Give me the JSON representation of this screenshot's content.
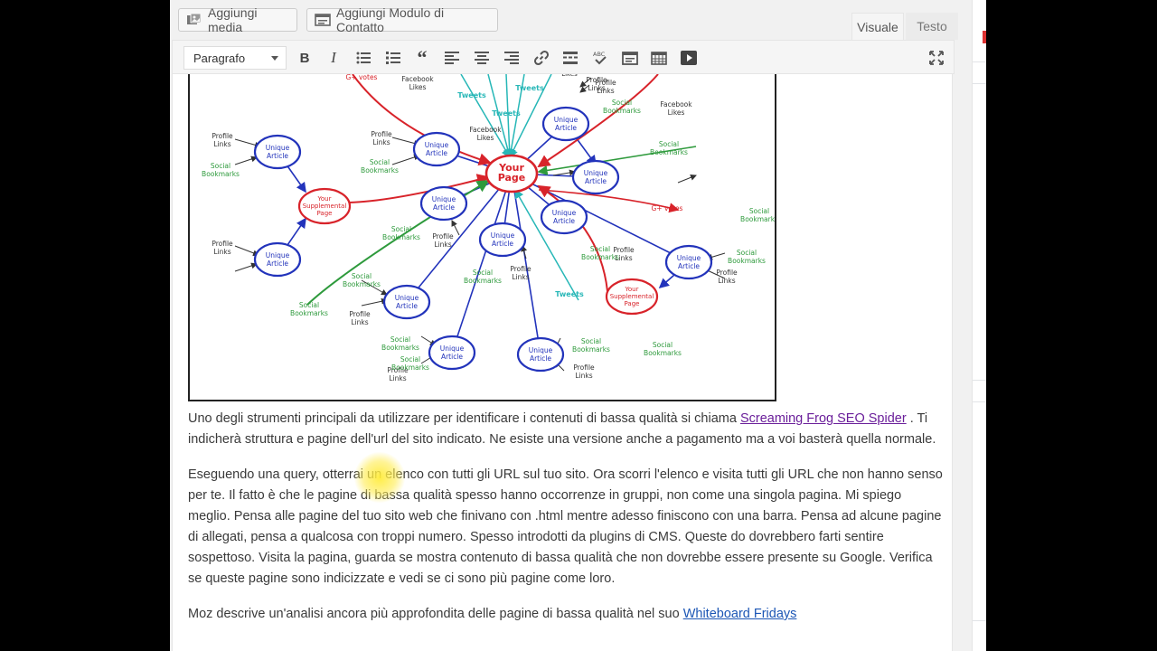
{
  "media_buttons": {
    "add_media": "Aggiungi media",
    "add_contact_form": "Aggiungi Modulo di Contatto"
  },
  "editor_tabs": {
    "visual": "Visuale",
    "text": "Testo",
    "active": "visual"
  },
  "toolbar": {
    "format_select": "Paragrafo",
    "buttons": [
      "bold",
      "italic",
      "bulleted-list",
      "numbered-list",
      "blockquote",
      "align-left",
      "align-center",
      "align-right",
      "insert-link",
      "read-more",
      "spellcheck",
      "toggle-toolbar",
      "insert-table",
      "insert-video",
      "fullscreen"
    ],
    "bold_label": "B",
    "italic_label": "I"
  },
  "diagram": {
    "center": "Your Page",
    "unique_article": "Unique Article",
    "supplemental": "Your Supplemental Page",
    "facebook_likes": "Facebook Likes",
    "tweets": "Tweets",
    "gplus": "G+ votes",
    "profile_links": "Profile Links",
    "social_bookmarks": "Social Bookmarks",
    "likes_partial": "Likes"
  },
  "content": {
    "p1_before": "Uno degli strumenti principali da utilizzare  per identificare i contenuti di bassa qualità si chiama ",
    "p1_link": "Screaming Frog SEO Spider",
    "p1_after": " . Ti indicherà struttura e pagine dell'url del sito indicato. Ne esiste una versione anche a pagamento ma a voi basterà quella normale.",
    "p2": "Eseguendo una query, otterrai un elenco con  tutti gli URL sul tuo sito. Ora scorri l'elenco e visita tutti gli URL che non hanno senso per te. Il fatto è che le pagine di bassa qualità spesso hanno occorrenze  in gruppi, non come una singola pagina. Mi spiego meglio. Pensa alle pagine  del tuo sito web che finivano con .html mentre adesso finiscono con una barra. Pensa ad alcune pagine di allegati, pensa a qualcosa con troppi numero. Spesso introdotti da plugins di CMS. Queste do dovrebbero farti sentire sospettoso. Visita la pagina, guarda se mostra contenuto di bassa qualità che non dovrebbe essere presente su Google. Verifica se queste pagine sono indicizzate e vedi se ci sono più pagine come loro.",
    "p3_before": "Moz descrive un'analisi ancora più approfondita delle pagine di bassa qualità nel suo ",
    "p3_link": "Whiteboard Fridays"
  },
  "colors": {
    "node_blue": "#2233bb",
    "center_red": "#d8232a",
    "arrow_green": "#2e9a3c",
    "arrow_cyan": "#27b7b7",
    "link_purple": "#6a1e9a",
    "link_blue": "#1c56b5"
  }
}
